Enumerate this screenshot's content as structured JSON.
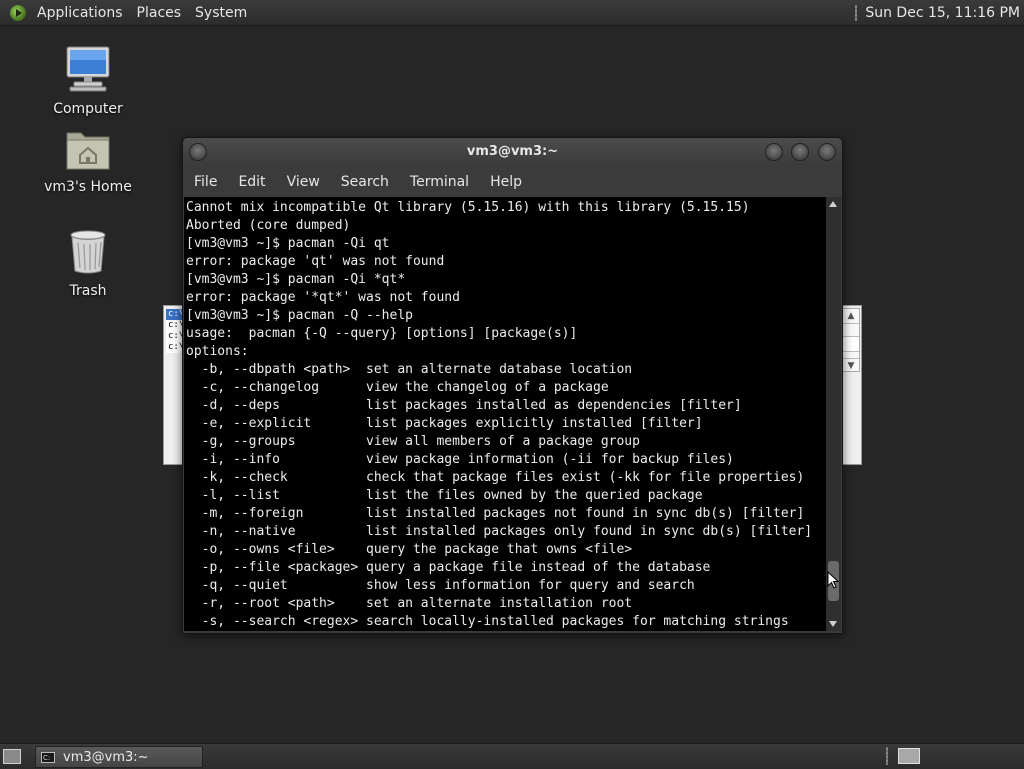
{
  "top_panel": {
    "menus": [
      "Applications",
      "Places",
      "System"
    ],
    "clock": "Sun Dec 15, 11:16 PM"
  },
  "desktop_icons": [
    {
      "label": "Computer",
      "icon": "computer-icon"
    },
    {
      "label": "vm3's Home",
      "icon": "home-folder-icon"
    },
    {
      "label": "Trash",
      "icon": "trash-icon"
    }
  ],
  "background_window": {
    "lines": [
      "c:\\",
      "c:\\",
      "c:\\",
      "c:\\"
    ]
  },
  "terminal": {
    "title": "vm3@vm3:~",
    "menus": [
      "File",
      "Edit",
      "View",
      "Search",
      "Terminal",
      "Help"
    ],
    "lines": [
      "Cannot mix incompatible Qt library (5.15.16) with this library (5.15.15)",
      "Aborted (core dumped)",
      "[vm3@vm3 ~]$ pacman -Qi qt",
      "error: package 'qt' was not found",
      "[vm3@vm3 ~]$ pacman -Qi *qt*",
      "error: package '*qt*' was not found",
      "[vm3@vm3 ~]$ pacman -Q --help",
      "usage:  pacman {-Q --query} [options] [package(s)]",
      "options:",
      "  -b, --dbpath <path>  set an alternate database location",
      "  -c, --changelog      view the changelog of a package",
      "  -d, --deps           list packages installed as dependencies [filter]",
      "  -e, --explicit       list packages explicitly installed [filter]",
      "  -g, --groups         view all members of a package group",
      "  -i, --info           view package information (-ii for backup files)",
      "  -k, --check          check that package files exist (-kk for file properties)",
      "  -l, --list           list the files owned by the queried package",
      "  -m, --foreign        list installed packages not found in sync db(s) [filter]",
      "  -n, --native         list installed packages only found in sync db(s) [filter]",
      "  -o, --owns <file>    query the package that owns <file>",
      "  -p, --file <package> query a package file instead of the database",
      "  -q, --quiet          show less information for query and search",
      "  -r, --root <path>    set an alternate installation root",
      "  -s, --search <regex> search locally-installed packages for matching strings"
    ]
  },
  "taskbar": {
    "task_label": "vm3@vm3:~",
    "task_icon_text": "C:"
  },
  "colors": {
    "desktop_bg": "#262626",
    "terminal_bg": "#000000",
    "terminal_fg": "#ececec",
    "panel_bg": "#333333"
  }
}
